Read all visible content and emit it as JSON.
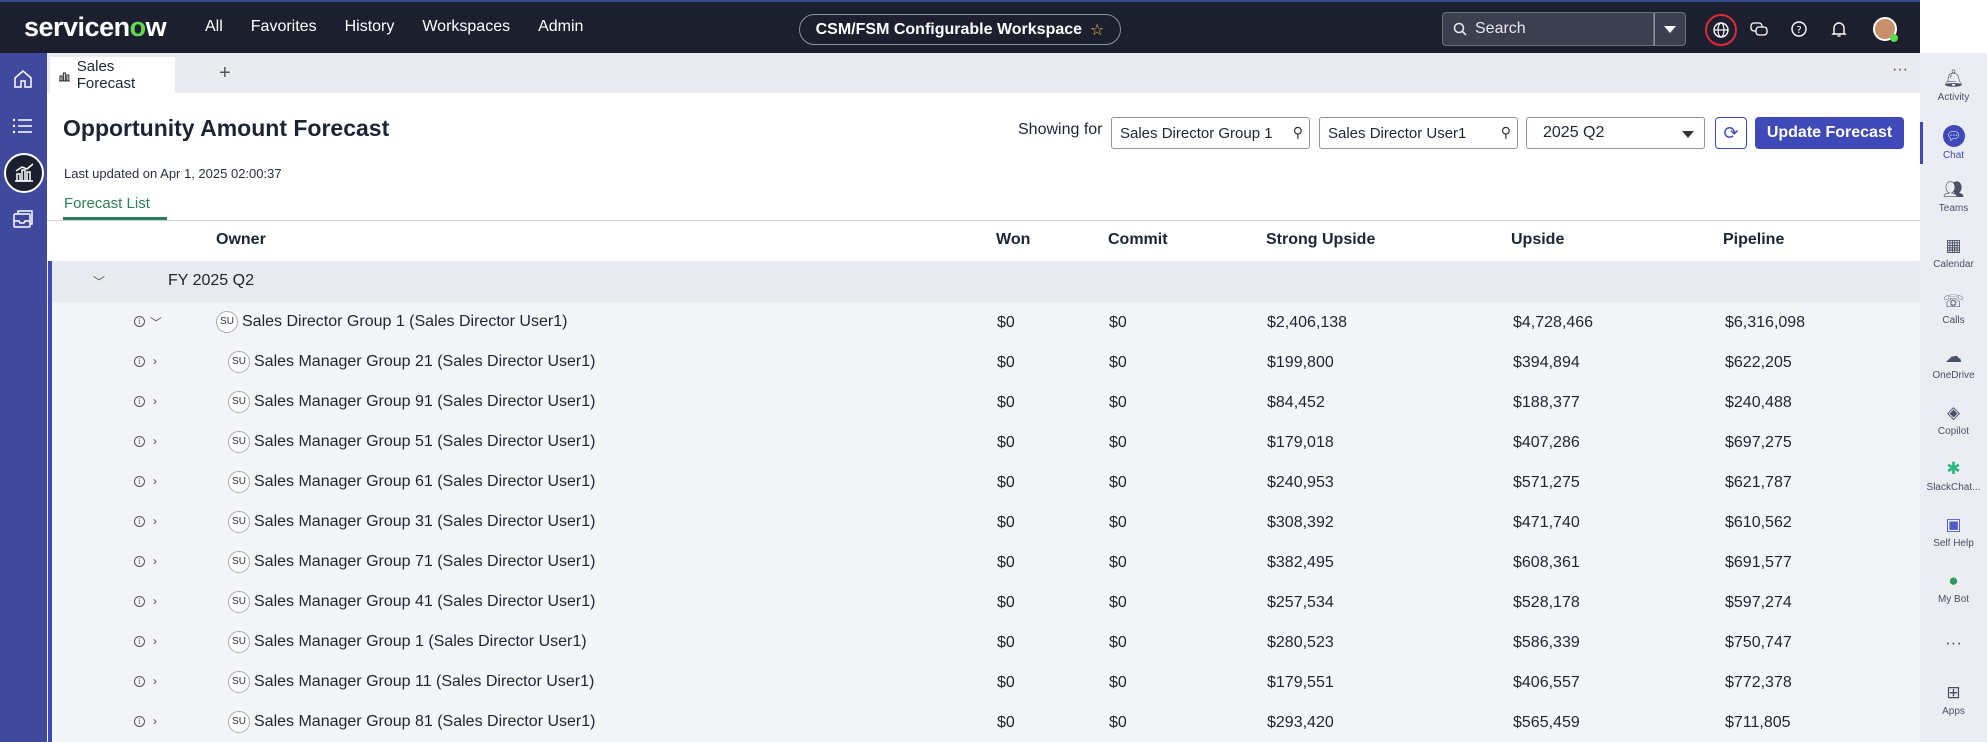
{
  "topbar": {
    "logo_text": "servicenow",
    "nav": [
      "All",
      "Favorites",
      "History",
      "Workspaces",
      "Admin"
    ],
    "workspace_label": "CSM/FSM Configurable Workspace",
    "search_placeholder": "Search"
  },
  "tab": {
    "label": "Sales Forecast"
  },
  "page": {
    "title": "Opportunity Amount Forecast",
    "last_updated": "Last updated on Apr 1, 2025 02:00:37",
    "showing_for_label": "Showing for",
    "group_field": "Sales Director Group 1",
    "user_field": "Sales Director User1",
    "period": "2025 Q2",
    "update_button": "Update Forecast",
    "subtab": "Forecast List"
  },
  "table": {
    "headers": [
      "Owner",
      "Won",
      "Commit",
      "Strong Upside",
      "Upside",
      "Pipeline"
    ],
    "group_label": "FY 2025 Q2",
    "rows": [
      {
        "owner": "Sales Director Group 1 (Sales Director User1)",
        "won": "$0",
        "commit": "$0",
        "strong": "$2,406,138",
        "upside": "$4,728,466",
        "pipeline": "$6,316,098",
        "level": 0
      },
      {
        "owner": "Sales Manager Group 21 (Sales Director User1)",
        "won": "$0",
        "commit": "$0",
        "strong": "$199,800",
        "upside": "$394,894",
        "pipeline": "$622,205",
        "level": 1
      },
      {
        "owner": "Sales Manager Group 91 (Sales Director User1)",
        "won": "$0",
        "commit": "$0",
        "strong": "$84,452",
        "upside": "$188,377",
        "pipeline": "$240,488",
        "level": 1
      },
      {
        "owner": "Sales Manager Group 51 (Sales Director User1)",
        "won": "$0",
        "commit": "$0",
        "strong": "$179,018",
        "upside": "$407,286",
        "pipeline": "$697,275",
        "level": 1
      },
      {
        "owner": "Sales Manager Group 61 (Sales Director User1)",
        "won": "$0",
        "commit": "$0",
        "strong": "$240,953",
        "upside": "$571,275",
        "pipeline": "$621,787",
        "level": 1
      },
      {
        "owner": "Sales Manager Group 31 (Sales Director User1)",
        "won": "$0",
        "commit": "$0",
        "strong": "$308,392",
        "upside": "$471,740",
        "pipeline": "$610,562",
        "level": 1
      },
      {
        "owner": "Sales Manager Group 71 (Sales Director User1)",
        "won": "$0",
        "commit": "$0",
        "strong": "$382,495",
        "upside": "$608,361",
        "pipeline": "$691,577",
        "level": 1
      },
      {
        "owner": "Sales Manager Group 41 (Sales Director User1)",
        "won": "$0",
        "commit": "$0",
        "strong": "$257,534",
        "upside": "$528,178",
        "pipeline": "$597,274",
        "level": 1
      },
      {
        "owner": "Sales Manager Group 1 (Sales Director User1)",
        "won": "$0",
        "commit": "$0",
        "strong": "$280,523",
        "upside": "$586,339",
        "pipeline": "$750,747",
        "level": 1
      },
      {
        "owner": "Sales Manager Group 11 (Sales Director User1)",
        "won": "$0",
        "commit": "$0",
        "strong": "$179,551",
        "upside": "$406,557",
        "pipeline": "$772,378",
        "level": 1
      },
      {
        "owner": "Sales Manager Group 81 (Sales Director User1)",
        "won": "$0",
        "commit": "$0",
        "strong": "$293,420",
        "upside": "$565,459",
        "pipeline": "$711,805",
        "level": 1
      }
    ],
    "avatar_initials": "SU"
  },
  "right_rail": [
    "Activity",
    "Chat",
    "Teams",
    "Calendar",
    "Calls",
    "OneDrive",
    "Copilot",
    "SlackChat...",
    "Self Help",
    "My Bot",
    "Apps"
  ],
  "colors": {
    "accent": "#3f4ab8",
    "topbar": "#1b1f2e",
    "rail": "#3f4a9e",
    "subtab": "#2e7d5b"
  }
}
